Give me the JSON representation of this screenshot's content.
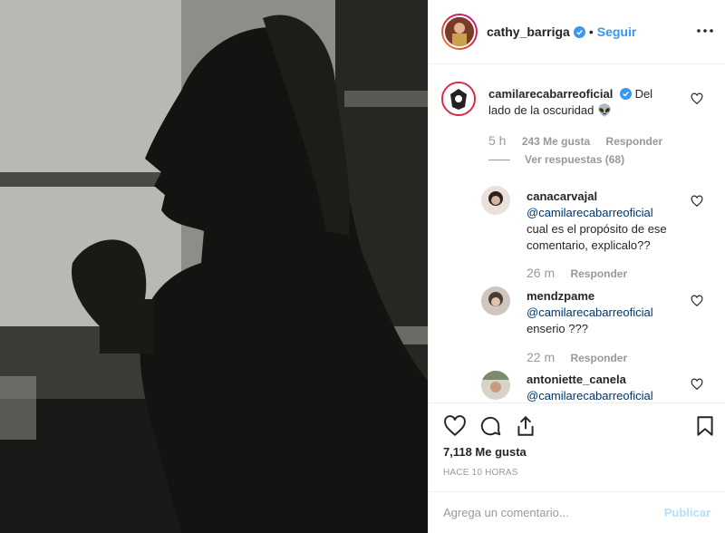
{
  "post": {
    "author": "cathy_barriga",
    "follow_label": "Seguir",
    "dot": "•",
    "likes": "7,118 Me gusta",
    "time_ago": "HACE 10 HORAS"
  },
  "comments": [
    {
      "user": "camilarecabarreoficial",
      "text_line1": "Del",
      "text_line2": "lado de la oscuridad 👽",
      "time": "5 h",
      "likes": "243 Me gusta",
      "reply": "Responder",
      "view_replies": "Ver respuestas (68)"
    },
    {
      "user": "canacarvajal",
      "mention": "@camilarecabarreoficial",
      "text_line1": "cual es el propósito de ese",
      "text_line2": "comentario, explicalo??",
      "time": "26 m",
      "reply": "Responder"
    },
    {
      "user": "mendzpame",
      "mention": "@camilarecabarreoficial",
      "text_line1": "enserio ???",
      "time": "22 m",
      "reply": "Responder"
    },
    {
      "user": "antoniette_canela",
      "mention": "@camilarecabarreoficial"
    }
  ],
  "add_comment": {
    "placeholder": "Agrega un comentario...",
    "publish_label": "Publicar"
  },
  "colors": {
    "link": "#3897f0",
    "verified": "#3897f0",
    "mention": "#003569"
  }
}
